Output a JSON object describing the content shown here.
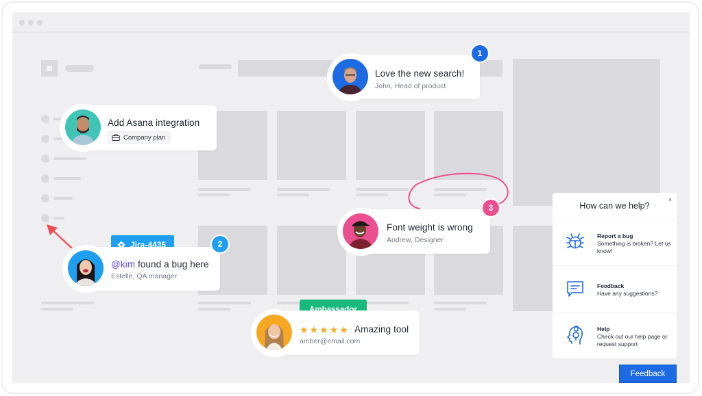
{
  "browser": {
    "window_dots": 3
  },
  "comments": [
    {
      "id": "love-search",
      "number": "1",
      "title": "Love the new search!",
      "subtitle": "John, Head of product",
      "accent": "#1c6be2",
      "avatar_bg": "#1c6be2"
    },
    {
      "id": "asana",
      "title": "Add Asana integration",
      "plan_label": "Company plan",
      "plan_icon": "briefcase-icon",
      "avatar_bg": "#3fc4b6"
    },
    {
      "id": "bug-here",
      "number": "2",
      "mention": "@kim",
      "title_rest": " found a bug here",
      "subtitle": "Estelle, QA manager",
      "accent": "#1f9ff0",
      "avatar_bg": "#1f9ff0",
      "tag": {
        "label": "Jira-4435",
        "icon": "jira-diamond-icon",
        "color": "#1f9ff0"
      }
    },
    {
      "id": "font-weight",
      "number": "3",
      "title": "Font weight is wrong",
      "subtitle": "Andrew, Designer",
      "accent": "#eb4f8f",
      "avatar_bg": "#eb4f8f"
    },
    {
      "id": "amazing-tool",
      "title": "Amazing tool",
      "subtitle": "amber@email.com",
      "rating": 5,
      "rating_max": 5,
      "avatar_bg": "#f7a823",
      "tag": {
        "label": "Ambassador",
        "color": "#17b97d"
      }
    }
  ],
  "help_panel": {
    "title": "How can we help?",
    "close_label": "×",
    "items": [
      {
        "icon": "bug-icon",
        "label": "Report a bug",
        "description": "Something is broken? Let us know!"
      },
      {
        "icon": "message-icon",
        "label": "Feedback",
        "description": "Have any suggestions?"
      },
      {
        "icon": "headset-icon",
        "label": "Help",
        "description": "Check out our help page or request support"
      }
    ],
    "accent": "#1c6be2"
  },
  "feedback_button": {
    "label": "Feedback",
    "color": "#1c6be2"
  },
  "colors": {
    "skeleton": "#dadade",
    "page_bg": "#efeff1",
    "annotation_pink": "#eb4f8f",
    "arrow_red": "#ef4f56",
    "star": "#f7a823"
  }
}
